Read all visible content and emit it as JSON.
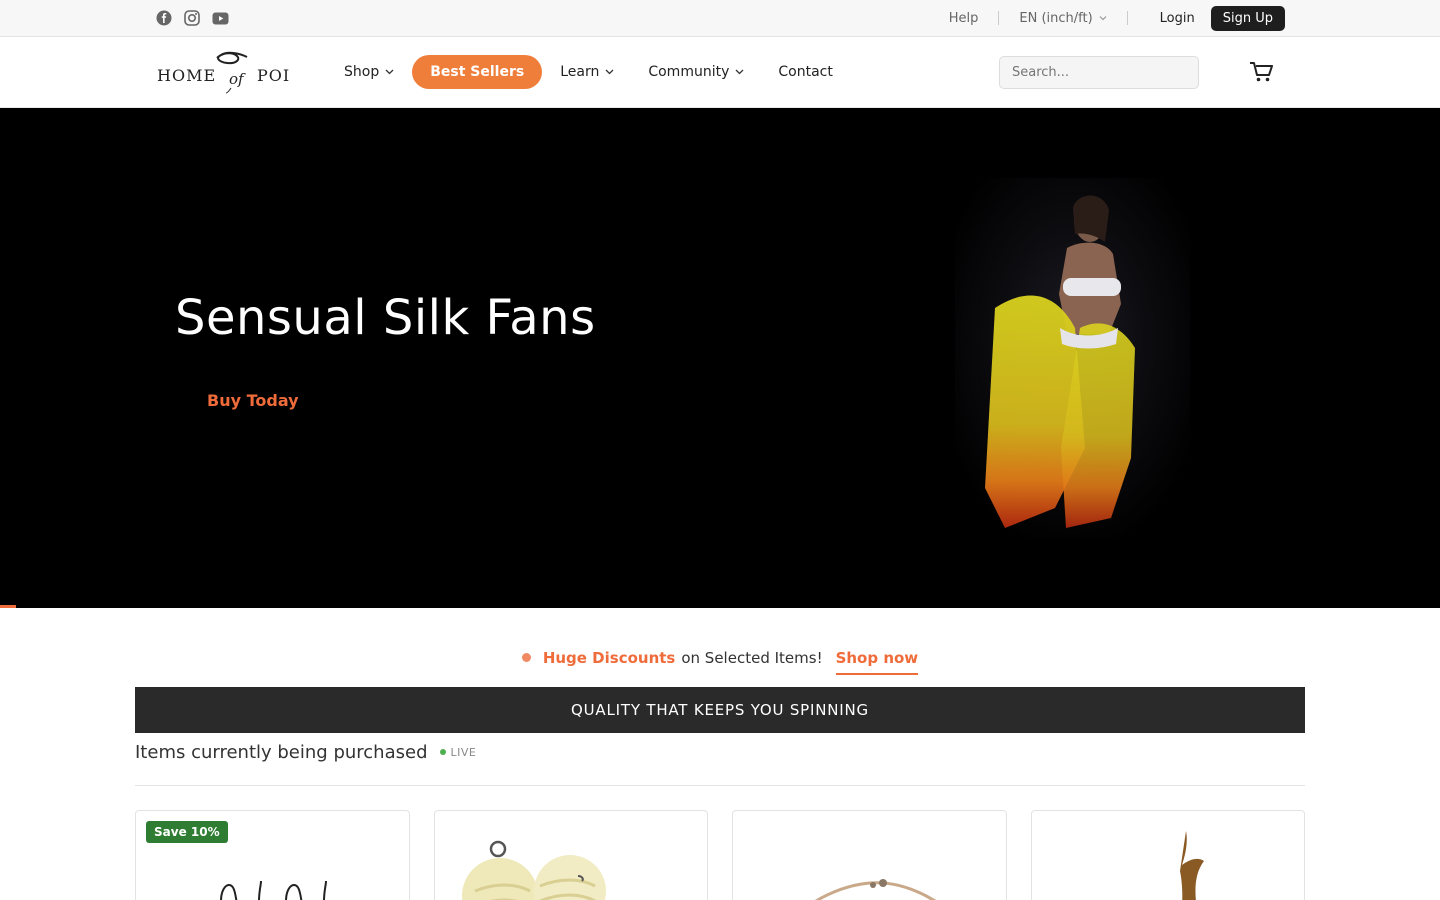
{
  "topbar": {
    "social": [
      "facebook-icon",
      "instagram-icon",
      "youtube-icon"
    ],
    "help": "Help",
    "language": "EN (inch/ft)",
    "login": "Login",
    "signup": "Sign Up"
  },
  "brand": {
    "logo_text_1": "HOME",
    "logo_text_2": "of",
    "logo_text_3": "POI"
  },
  "nav": {
    "items": [
      {
        "label": "Shop",
        "dropdown": true
      },
      {
        "label": "Best Sellers",
        "dropdown": false
      },
      {
        "label": "Learn",
        "dropdown": true
      },
      {
        "label": "Community",
        "dropdown": true
      },
      {
        "label": "Contact",
        "dropdown": false
      }
    ],
    "search_placeholder": "Search..."
  },
  "hero": {
    "title": "Sensual Silk Fans",
    "cta": "Buy Today"
  },
  "promo": {
    "highlight": "Huge Discounts",
    "text": "on Selected Items!",
    "link": "Shop now"
  },
  "tagline": "QUALITY THAT KEEPS YOU SPINNING",
  "live": {
    "title": "Items currently being purchased",
    "badge": "LIVE"
  },
  "products": [
    {
      "badge": "Save 10%",
      "image": "staff-hoop-image"
    },
    {
      "badge": "",
      "image": "fire-poi-wicks-image"
    },
    {
      "badge": "",
      "image": "rope-necklace-image"
    },
    {
      "badge": "",
      "image": "wooden-hook-image"
    }
  ],
  "colors": {
    "accent": "#ef7e3a",
    "cta": "#ef6b3a",
    "dark": "#1e1e1e",
    "live": "#4caf50",
    "save": "#2e7d32"
  }
}
